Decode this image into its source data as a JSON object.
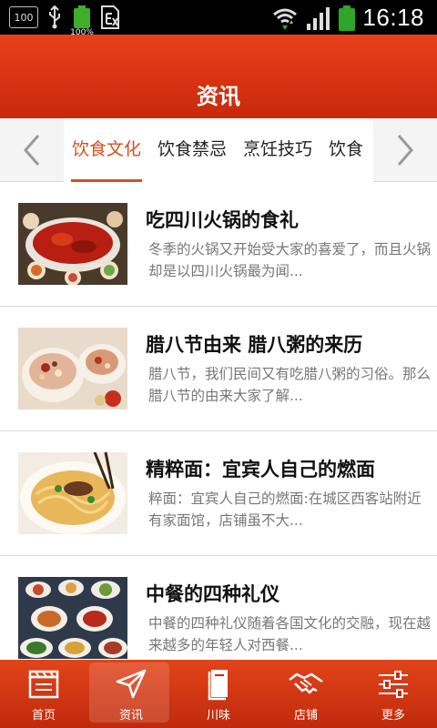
{
  "status_bar": {
    "left_badge": "100",
    "battery_small_pct": "100%",
    "time": "16:18"
  },
  "header": {
    "title": "资讯"
  },
  "tabs": [
    {
      "label": "饮食文化",
      "active": true
    },
    {
      "label": "饮食禁忌",
      "active": false
    },
    {
      "label": "烹饪技巧",
      "active": false
    },
    {
      "label": "饮食",
      "active": false
    }
  ],
  "articles": [
    {
      "title": "吃四川火锅的食礼",
      "desc": "冬季的火锅又开始受大家的喜爱了，而且火锅却是以四川火锅最为闻...",
      "image": "hotpot-photo"
    },
    {
      "title": "腊八节由来 腊八粥的来历",
      "desc": "腊八节，我们民间又有吃腊八粥的习俗。那么腊八节的由来大家了解...",
      "image": "laba-porridge-photo"
    },
    {
      "title": "精粹面：宜宾人自己的燃面",
      "desc": "粹面：宜宾人自己的燃面:在城区西客站附近有家面馆，店铺虽不大...",
      "image": "noodles-photo"
    },
    {
      "title": "中餐的四种礼仪",
      "desc": "中餐的四种礼仪随着各国文化的交融，现在越来越多的年轻人对西餐...",
      "image": "chinese-dishes-photo"
    }
  ],
  "bottom_nav": [
    {
      "label": "首页",
      "icon": "film-board-icon",
      "active": false
    },
    {
      "label": "资讯",
      "icon": "paper-plane-icon",
      "active": true
    },
    {
      "label": "川味",
      "icon": "book-icon",
      "active": false
    },
    {
      "label": "店铺",
      "icon": "handshake-icon",
      "active": false
    },
    {
      "label": "更多",
      "icon": "sliders-icon",
      "active": false
    }
  ],
  "colors": {
    "accent": "#d4501c",
    "header": "#d8341a"
  }
}
